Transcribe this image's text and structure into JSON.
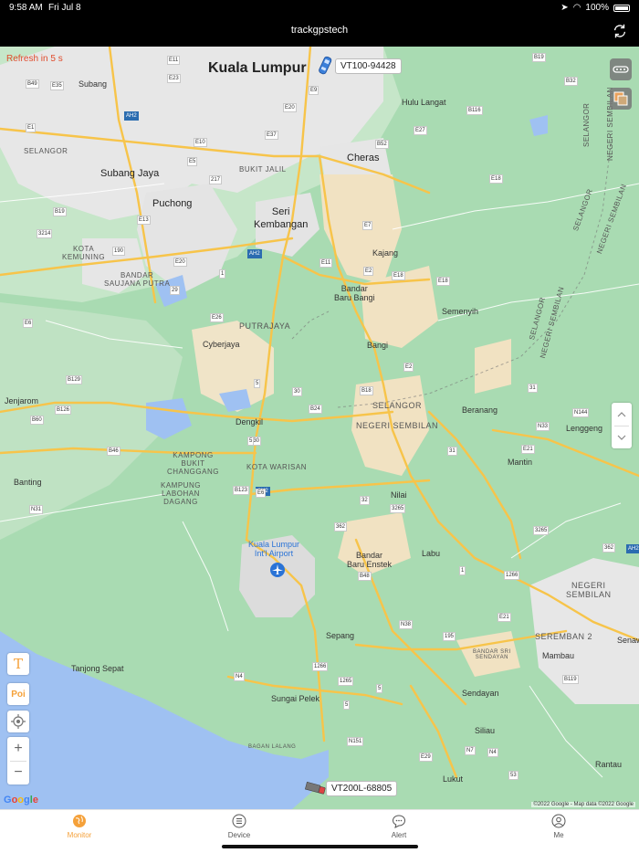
{
  "status_bar": {
    "time": "9:58 AM",
    "date": "Fri Jul 8",
    "battery": "100%"
  },
  "nav": {
    "title": "trackgpstech"
  },
  "map": {
    "refresh_text": "Refresh in 5 s",
    "vehicles": [
      {
        "label": "VT100-94428",
        "icon": "car-icon",
        "color": "#3b7fd9"
      },
      {
        "label": "VT200L-68805",
        "icon": "truck-icon",
        "color": "#666666"
      }
    ],
    "places": {
      "kuala_lumpur": "Kuala Lumpur",
      "subang": "Subang",
      "selangor_nw": "SELANGOR",
      "subang_jaya": "Subang Jaya",
      "bukit_jalil": "BUKIT JALIL",
      "cheras": "Cheras",
      "puchong": "Puchong",
      "seri_kembangan": "Seri\nKembangan",
      "hulu_langat": "Hulu Langat",
      "kota_kemuning": "KOTA\nKEMUNING",
      "kajang": "Kajang",
      "bandar_saujana_putra": "BANDAR\nSAUJANA PUTRA",
      "bandar_baru_bangi": "Bandar\nBaru Bangi",
      "putrajaya": "PUTRAJAYA",
      "semenyih": "Semenyih",
      "cyberjaya": "Cyberjaya",
      "bangi": "Bangi",
      "jenjarom": "Jenjarom",
      "selangor_mid": "SELANGOR",
      "negeri_sembilan_mid": "NEGERI SEMBILAN",
      "beranang": "Beranang",
      "dengkil": "Dengkil",
      "lenggeng": "Lenggeng",
      "kampong_bukit_changgang": "KAMPONG\nBUKIT\nCHANGGANG",
      "banting": "Banting",
      "kota_warisan": "KOTA WARISAN",
      "mantin": "Mantin",
      "kampung_labohan_dagang": "KAMPUNG\nLABOHAN\nDAGANG",
      "nilai": "Nilai",
      "airport": "Kuala Lumpur\nInt'l Airport",
      "bandar_baru_enstek": "Bandar\nBaru Enstek",
      "labu": "Labu",
      "negeri_sembilan_se": "NEGERI\nSEMBILAN",
      "seremban_2": "SEREMBAN 2",
      "bandar_sri_sendayan": "BANDAR SRI\nSENDAYAN",
      "sepang": "Sepang",
      "tanjong_sepat": "Tanjong Sepat",
      "mambau": "Mambau",
      "senawang": "Senawa",
      "sungai_pelek": "Sungai Pelek",
      "sendayan": "Sendayan",
      "siliau": "Siliau",
      "bagan_lalang": "BAGAN LALANG",
      "rantau": "Rantau",
      "lukut": "Lukut",
      "selangor_v1": "SELANGOR",
      "negeri_sembilan_v1": "NEGERI SEMBILAN",
      "selangor_v2": "SELANGOR",
      "negeri_sembilan_v2": "NEGERI SEMBILAN",
      "selangor_v3": "SELANGOR",
      "negeri_sembilan_v3": "NEGERI SEMBILAN"
    },
    "shields": [
      "E11",
      "B49",
      "E35",
      "E23",
      "E9",
      "B19",
      "B32",
      "E1",
      "AH2",
      "E20",
      "B116",
      "E37",
      "B52",
      "E27",
      "E10",
      "E5",
      "217",
      "E18",
      "B19",
      "E13",
      "3214",
      "E7",
      "190",
      "AH2",
      "E20",
      "E11",
      "E2",
      "E18",
      "E18",
      "1",
      "29",
      "E26",
      "E6",
      "B129",
      "B126",
      "B60",
      "5",
      "30",
      "B18",
      "E2",
      "B24",
      "B46",
      "31",
      "N144",
      "N33",
      "N30",
      "AH2",
      "31",
      "E21",
      "N31",
      "B123",
      "E6",
      "32",
      "3265",
      "362",
      "3265",
      "B48",
      "1",
      "1266",
      "362",
      "AH2",
      "E21",
      "N38",
      "195",
      "1266",
      "1265",
      "5",
      "N4",
      "5",
      "B119",
      "N151",
      "N7",
      "N4",
      "E29",
      "53",
      "5",
      "N6",
      "AH2"
    ],
    "airport_icon": "airplane-icon",
    "google_logo": "Google",
    "copyright": "©2022 Google - Map data ©2022 Google"
  },
  "tabs": [
    {
      "label": "Monitor",
      "icon": "globe-icon",
      "active": true
    },
    {
      "label": "Device",
      "icon": "list-icon",
      "active": false
    },
    {
      "label": "Alert",
      "icon": "chat-icon",
      "active": false
    },
    {
      "label": "Me",
      "icon": "person-icon",
      "active": false
    }
  ],
  "colors": {
    "accent": "#f5a13a",
    "refresh_text": "#e04b2c",
    "sea": "#9fc1f2",
    "land": "#a9dbb2",
    "urban": "#e7e7e7",
    "road": "#f7c44a"
  }
}
